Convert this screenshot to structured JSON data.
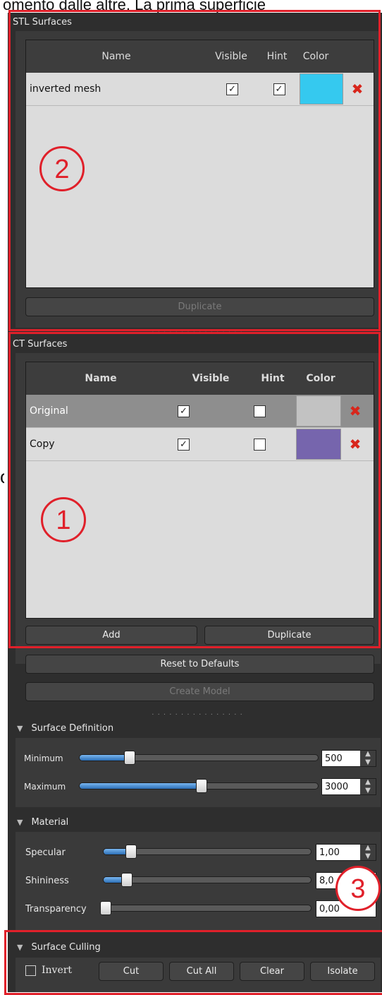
{
  "caption": {
    "top_text": "omento dalle altre. La prima superficie",
    "left_char": "o"
  },
  "stl": {
    "title": "STL Surfaces",
    "columns": {
      "name": "Name",
      "visible": "Visible",
      "hint": "Hint",
      "color": "Color"
    },
    "rows": [
      {
        "name": "inverted mesh",
        "visible": true,
        "hint": true,
        "color": "#35c9ef"
      }
    ],
    "duplicate_label": "Duplicate",
    "annotation": "2"
  },
  "ct": {
    "title": "CT Surfaces",
    "columns": {
      "name": "Name",
      "visible": "Visible",
      "hint": "Hint",
      "color": "Color"
    },
    "rows": [
      {
        "name": "Original",
        "visible": true,
        "hint": false,
        "color": "#c2c2c2",
        "selected": true
      },
      {
        "name": "Copy",
        "visible": true,
        "hint": false,
        "color": "#7665ad",
        "selected": false
      }
    ],
    "add_label": "Add",
    "duplicate_label": "Duplicate",
    "annotation": "1"
  },
  "actions": {
    "reset_label": "Reset to Defaults",
    "create_label": "Create Model"
  },
  "surface_definition": {
    "title": "Surface Definition",
    "minimum_label": "Minimum",
    "minimum_value": "500",
    "minimum_fraction": 0.2,
    "maximum_label": "Maximum",
    "maximum_value": "3000",
    "maximum_fraction": 0.5
  },
  "material": {
    "title": "Material",
    "specular_label": "Specular",
    "specular_value": "1,00",
    "specular_fraction": 0.12,
    "shininess_label": "Shininess",
    "shininess_value": "8,0",
    "shininess_fraction": 0.1,
    "transparency_label": "Transparency",
    "transparency_value": "0,00",
    "transparency_fraction": 0.0,
    "annotation": "3"
  },
  "culling": {
    "title": "Surface Culling",
    "invert_label": "Invert",
    "invert_checked": false,
    "cut_label": "Cut",
    "cut_all_label": "Cut All",
    "clear_label": "Clear",
    "isolate_label": "Isolate"
  },
  "colors": {
    "annotation_red": "#e0202a",
    "delete_red": "#d8261c",
    "slider_blue": "#3a86d6"
  }
}
